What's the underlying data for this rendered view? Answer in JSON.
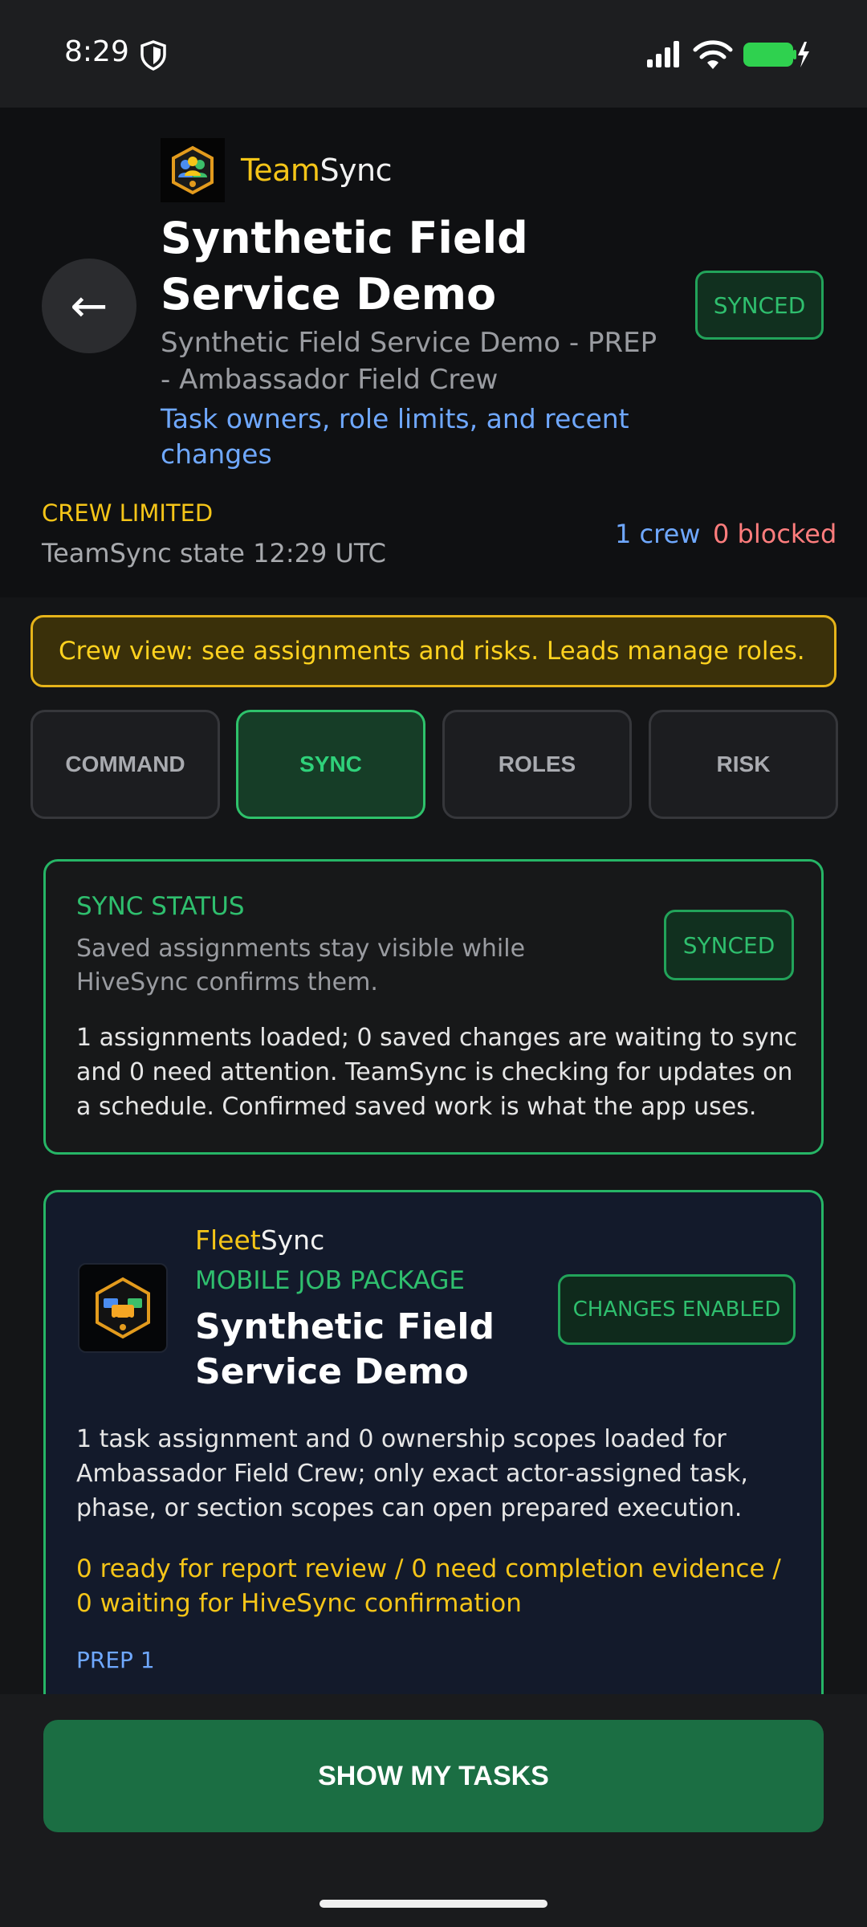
{
  "status_bar": {
    "time": "8:29"
  },
  "header": {
    "brand_prefix": "Team",
    "brand_suffix": "Sync",
    "title": "Synthetic Field Service Demo",
    "subtitle": "Synthetic Field Service Demo - PREP - Ambassador Field Crew",
    "link": "Task owners, role limits, and recent changes",
    "badge": "SYNCED",
    "crew_limited": "CREW LIMITED",
    "state_time": "TeamSync state 12:29 UTC",
    "crew_count": "1 crew",
    "blocked_count": "0 blocked"
  },
  "banner": {
    "text": "Crew view: see assignments and risks. Leads manage roles."
  },
  "tabs": [
    {
      "label": "COMMAND"
    },
    {
      "label": "SYNC"
    },
    {
      "label": "ROLES"
    },
    {
      "label": "RISK"
    }
  ],
  "active_tab": "SYNC",
  "sync_card": {
    "label": "SYNC STATUS",
    "description": "Saved assignments stay visible while HiveSync confirms them.",
    "badge": "SYNCED",
    "body": "1 assignments loaded; 0 saved changes are waiting to sync and 0 need attention. TeamSync is checking for updates on a schedule. Confirmed saved work is what the app uses."
  },
  "fleet_card": {
    "brand_prefix": "Fleet",
    "brand_suffix": "Sync",
    "kicker": "MOBILE JOB PACKAGE",
    "title": "Synthetic Field Service Demo",
    "badge": "CHANGES ENABLED",
    "body": "1 task assignment and 0 ownership scopes loaded for Ambassador Field Crew; only exact actor-assigned task, phase, or section scopes can open prepared execution.",
    "warning": "0 ready for report review / 0 need completion evidence / 0 waiting for HiveSync confirmation",
    "prep_label": "PREP 1"
  },
  "bottom": {
    "cta": "SHOW MY TASKS"
  },
  "colors": {
    "accent_green": "#2fbf6e",
    "brand_yellow": "#f5c518",
    "link_blue": "#6fa8ff",
    "danger_red": "#ff7d7d",
    "cta_green": "#1b6e43"
  },
  "icons": [
    "shield-icon",
    "signal-icon",
    "wifi-icon",
    "battery-charging-icon",
    "back-arrow-icon",
    "teamsync-logo-icon",
    "fleetsync-logo-icon"
  ]
}
